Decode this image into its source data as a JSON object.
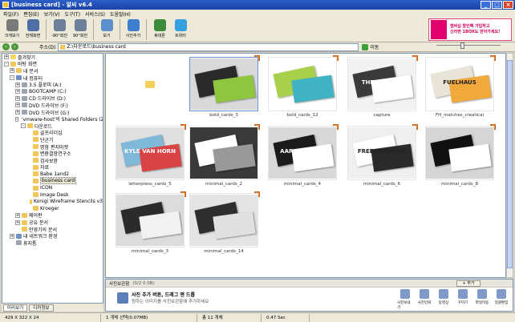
{
  "window": {
    "title": "[business card] - 알씨 v6.4"
  },
  "menu": [
    "파일(F)",
    "편집(E)",
    "보기(V)",
    "도구(T)",
    "서비스(S)",
    "도움말(H)"
  ],
  "toolbar": [
    {
      "label": "크게보기",
      "icon": "magnifier-icon",
      "color": "#7a7a7a"
    },
    {
      "label": "전체화면",
      "icon": "fullscreen-icon",
      "color": "#4f6ea6"
    },
    {
      "label": "-90°회전",
      "icon": "rotate-left-icon",
      "color": "#6e7f99"
    },
    {
      "label": "90°회전",
      "icon": "rotate-right-icon",
      "color": "#6e7f99"
    },
    {
      "label": "보기",
      "icon": "view-grid-icon",
      "color": "#5d8fc9"
    },
    {
      "label": "사진추가",
      "icon": "add-photo-icon",
      "color": "#3c7fd0"
    },
    {
      "label": "휴대폰",
      "icon": "phone-icon",
      "color": "#3c8c3c"
    },
    {
      "label": "트위터",
      "icon": "twitter-icon",
      "color": "#35a0e0"
    }
  ],
  "ad": {
    "line1": "멤버십 할인팩 가입하고",
    "line2": "신라면 1BOX도 받아가세요!"
  },
  "address": {
    "label": "주소(D)",
    "value": "Z:\\다운로드\\business card",
    "go_label": "이동"
  },
  "tree": [
    {
      "label": "즐겨찾기",
      "indent": 0,
      "exp": "+",
      "icon": "star"
    },
    {
      "label": "바탕 화면",
      "indent": 0,
      "exp": "-",
      "icon": "folder"
    },
    {
      "label": "내 문서",
      "indent": 1,
      "exp": "+",
      "icon": "folder"
    },
    {
      "label": "내 컴퓨터",
      "indent": 1,
      "exp": "-",
      "icon": "pc"
    },
    {
      "label": "3.5 플로피 (A:)",
      "indent": 2,
      "exp": "+",
      "icon": "drive"
    },
    {
      "label": "BOOTCAMP (C:)",
      "indent": 2,
      "exp": "+",
      "icon": "drive"
    },
    {
      "label": "CD 드라이브 (D:)",
      "indent": 2,
      "exp": "+",
      "icon": "drive"
    },
    {
      "label": "DVD 드라이브 (F:)",
      "indent": 2,
      "exp": "+",
      "icon": "drive"
    },
    {
      "label": "DVD 드라이브 (G:)",
      "indent": 2,
      "exp": "+",
      "icon": "drive"
    },
    {
      "label": "'vmware-host'의 Shared Folders (Z:)",
      "indent": 2,
      "exp": "-",
      "icon": "drive"
    },
    {
      "label": "다운로드",
      "indent": 3,
      "exp": "-",
      "icon": "folder"
    },
    {
      "label": "골프리더십",
      "indent": 4,
      "exp": "",
      "icon": "folder"
    },
    {
      "label": "단군기",
      "indent": 4,
      "exp": "",
      "icon": "folder"
    },
    {
      "label": "명함 편지마켓",
      "indent": 4,
      "exp": "",
      "icon": "folder"
    },
    {
      "label": "변환결함연구소",
      "indent": 4,
      "exp": "",
      "icon": "folder"
    },
    {
      "label": "검사보완",
      "indent": 4,
      "exp": "",
      "icon": "folder"
    },
    {
      "label": "자료",
      "indent": 4,
      "exp": "",
      "icon": "folder"
    },
    {
      "label": "Babe 1and2",
      "indent": 4,
      "exp": "",
      "icon": "folder"
    },
    {
      "label": "business card",
      "indent": 4,
      "exp": "",
      "icon": "folder",
      "selected": true
    },
    {
      "label": "ICON",
      "indent": 4,
      "exp": "",
      "icon": "folder"
    },
    {
      "label": "Image Desk",
      "indent": 4,
      "exp": "",
      "icon": "folder"
    },
    {
      "label": "Konigi Wireframe Stencils v3",
      "indent": 4,
      "exp": "",
      "icon": "folder"
    },
    {
      "label": "Kroeger",
      "indent": 4,
      "exp": "",
      "icon": "folder"
    },
    {
      "label": "제어판",
      "indent": 2,
      "exp": "+",
      "icon": "folder"
    },
    {
      "label": "공유 문서",
      "indent": 2,
      "exp": "+",
      "icon": "folder"
    },
    {
      "label": "안영기의 문서",
      "indent": 2,
      "exp": "",
      "icon": "folder"
    },
    {
      "label": "내 네트워크 환경",
      "indent": 1,
      "exp": "+",
      "icon": "pc"
    },
    {
      "label": "휴지통",
      "indent": 1,
      "exp": "",
      "icon": "drive"
    }
  ],
  "side_tabs": [
    "미리보기",
    "디카정보"
  ],
  "thumbnails": [
    {
      "name": "..",
      "type": "folder"
    },
    {
      "name": "bold_cards_3",
      "bg": "#d9d9d9",
      "fg": "#2a2a2a",
      "accent": "#8fc640",
      "selected": true
    },
    {
      "name": "bold_cards_12",
      "bg": "#ffffff",
      "fg": "#a8d14b",
      "accent": "#3fb3c4"
    },
    {
      "name": "capture",
      "bg": "#f2f2f2",
      "fg": "#3a3a3a",
      "accent": "#ffffff",
      "text": "THEMESHIFT"
    },
    {
      "name": "FH_matches_creatical",
      "bg": "#ffffff",
      "fg": "#e8e4d8",
      "accent": "#f2a93b",
      "text": "FUELHAUS"
    },
    {
      "name": "letterpress_cards_5",
      "bg": "#e0e0e0",
      "fg": "#7fb8d9",
      "accent": "#d94343",
      "text": "KYLE VAN HORN"
    },
    {
      "name": "minimal_cards_2",
      "bg": "#3a3a3a",
      "fg": "#ffffff",
      "accent": "#999999"
    },
    {
      "name": "minimal_cards_4",
      "bg": "#d8d8d8",
      "fg": "#1b1b1b",
      "accent": "#ffffff",
      "text": "AARON KAPLE"
    },
    {
      "name": "minimal_cards_6",
      "bg": "#efefef",
      "fg": "#ffffff",
      "accent": "#2a2a2a",
      "text": "FREDERICKVAN"
    },
    {
      "name": "minimal_cards_8",
      "bg": "#d5d5d5",
      "fg": "#111111",
      "accent": "#ffffff"
    },
    {
      "name": "minimal_cards_3",
      "bg": "#dcdcdc",
      "fg": "#2b2b2b",
      "accent": "#f1f1f1"
    },
    {
      "name": "minimal_cards_14",
      "bg": "#e4e4e4",
      "fg": "#2e2e2e",
      "accent": "#e0e0e0"
    }
  ],
  "bottom_panel": {
    "title": "사진보관함",
    "count": "(0/2 0.0B)",
    "add_label": "+ 추가",
    "msg1": "사진 추가 버튼, 드래그 앤 드롭",
    "msg2": "원하는 이미지를 사진보관함에 추가하세요",
    "actions": [
      "사진보내기",
      "사진인화",
      "동영상",
      "꾸미기",
      "파일이동",
      "일괄편집"
    ]
  },
  "status": [
    "429 X 322 X 24",
    "1 개체 선택(0.07MB)",
    "총 11 개체",
    "0.47 Sec"
  ],
  "colors": {
    "title_bg": "#2c5fc7",
    "selected_frame": "#6c95d8"
  }
}
